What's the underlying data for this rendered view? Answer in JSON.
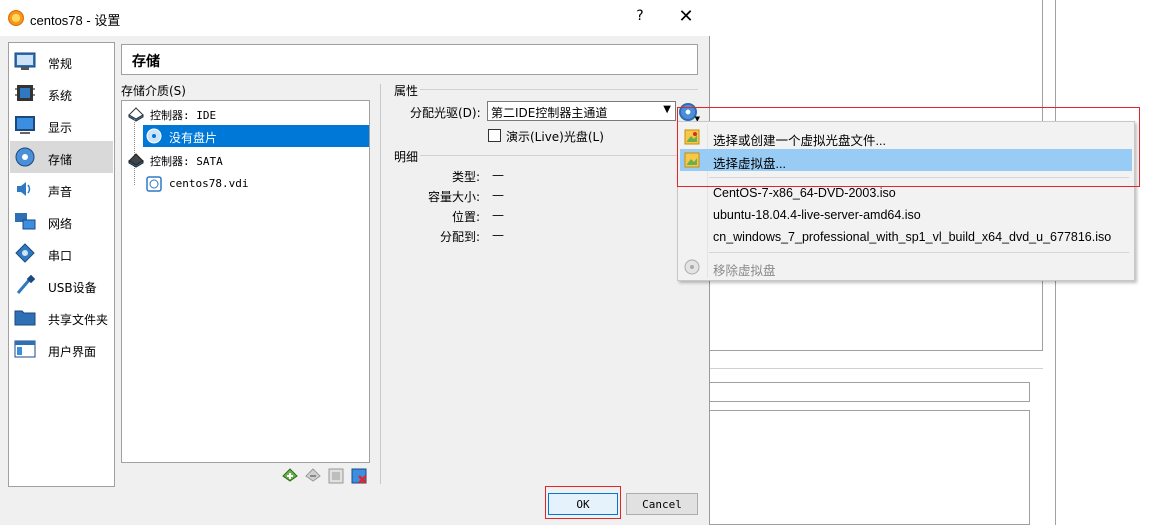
{
  "window": {
    "title": "centos78 - 设置",
    "help_label": "?",
    "close_label": "✕"
  },
  "categories": [
    {
      "label": "常规",
      "icon": "general-icon"
    },
    {
      "label": "系统",
      "icon": "system-icon"
    },
    {
      "label": "显示",
      "icon": "display-icon"
    },
    {
      "label": "存储",
      "icon": "storage-icon",
      "selected": true
    },
    {
      "label": "声音",
      "icon": "audio-icon"
    },
    {
      "label": "网络",
      "icon": "network-icon"
    },
    {
      "label": "串口",
      "icon": "serial-port-icon"
    },
    {
      "label": "USB设备",
      "icon": "usb-icon"
    },
    {
      "label": "共享文件夹",
      "icon": "shared-folder-icon"
    },
    {
      "label": "用户界面",
      "icon": "user-interface-icon"
    }
  ],
  "section": {
    "title": "存储"
  },
  "storage": {
    "label": "存储介质(S)",
    "tree": {
      "ide_controller": "控制器: IDE",
      "ide_child": "没有盘片",
      "sata_controller": "控制器: SATA",
      "sata_child": "centos78.vdi"
    }
  },
  "attributes": {
    "title": "属性",
    "drive_label": "分配光驱(D):",
    "drive_value": "第二IDE控制器主通道",
    "live_cd_label": "演示(Live)光盘(L)",
    "live_cd_checked": false
  },
  "details": {
    "title": "明细",
    "rows": [
      {
        "key": "类型:",
        "value": "—"
      },
      {
        "key": "容量大小:",
        "value": "—"
      },
      {
        "key": "位置:",
        "value": "—"
      },
      {
        "key": "分配到:",
        "value": "—"
      }
    ]
  },
  "buttons": {
    "ok": "OK",
    "cancel": "Cancel"
  },
  "menu": {
    "items": [
      {
        "label": "选择或创建一个虚拟光盘文件...",
        "icon": "add-disc-icon"
      },
      {
        "label": "选择虚拟盘...",
        "icon": "choose-disc-icon",
        "highlighted": true
      },
      {
        "label": "CentOS-7-x86_64-DVD-2003.iso"
      },
      {
        "label": "ubuntu-18.04.4-live-server-amd64.iso"
      },
      {
        "label": "cn_windows_7_professional_with_sp1_vl_build_x64_dvd_u_677816.iso"
      },
      {
        "label": "移除虚拟盘",
        "icon": "remove-disc-icon",
        "disabled": true
      }
    ]
  },
  "colors": {
    "selection": "#0078d7",
    "menu_highlight": "#99ccf5",
    "annotation": "#e0262a"
  }
}
